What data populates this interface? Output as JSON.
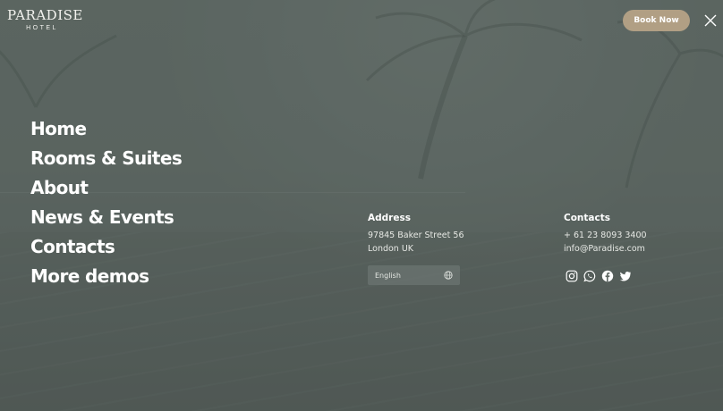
{
  "brand": {
    "name": "PARADISE",
    "sub": "HOTEL"
  },
  "header": {
    "book_label": "Book Now"
  },
  "nav": {
    "items": [
      {
        "label": "Home"
      },
      {
        "label": "Rooms & Suites"
      },
      {
        "label": "About"
      },
      {
        "label": "News & Events"
      },
      {
        "label": "Contacts"
      },
      {
        "label": "More demos"
      }
    ]
  },
  "address": {
    "title": "Address",
    "line1": "97845 Baker Street 56",
    "line2": "London UK"
  },
  "contacts": {
    "title": "Contacts",
    "phone": "+ 61 23 8093 3400",
    "email": "info@Paradise.com"
  },
  "language": {
    "selected": "English"
  },
  "social": [
    "instagram-icon",
    "whatsapp-icon",
    "facebook-icon",
    "twitter-icon"
  ],
  "colors": {
    "accent": "#b19f84",
    "overlay": "#5a625e",
    "text": "#ffffff"
  }
}
